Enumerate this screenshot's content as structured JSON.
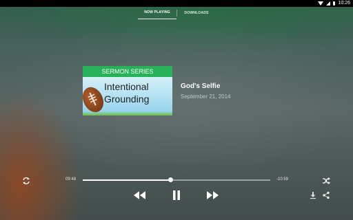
{
  "status_bar": {
    "time": "10:26",
    "icons": [
      "wifi-icon",
      "signal-icon",
      "battery-icon"
    ]
  },
  "tabs": [
    {
      "label": "NOW PLAYING",
      "active": true
    },
    {
      "label": "DOWNLOADS",
      "active": false
    }
  ],
  "artwork": {
    "banner": "SERMON SERIES",
    "line1": "Intentional",
    "line2": "Grounding",
    "icon": "football"
  },
  "track": {
    "title": "God's Selfie",
    "date": "September 21, 2014"
  },
  "player": {
    "elapsed": "09:48",
    "remaining": "-10:59",
    "progress_fraction": 0.47,
    "controls": [
      "repeat-icon",
      "rewind-icon",
      "pause-icon",
      "fast-forward-icon",
      "shuffle-icon",
      "download-icon",
      "share-icon"
    ]
  },
  "colors": {
    "art_banner": "#27b25a",
    "status_bar": "#000000",
    "accent": "#ffffff"
  }
}
